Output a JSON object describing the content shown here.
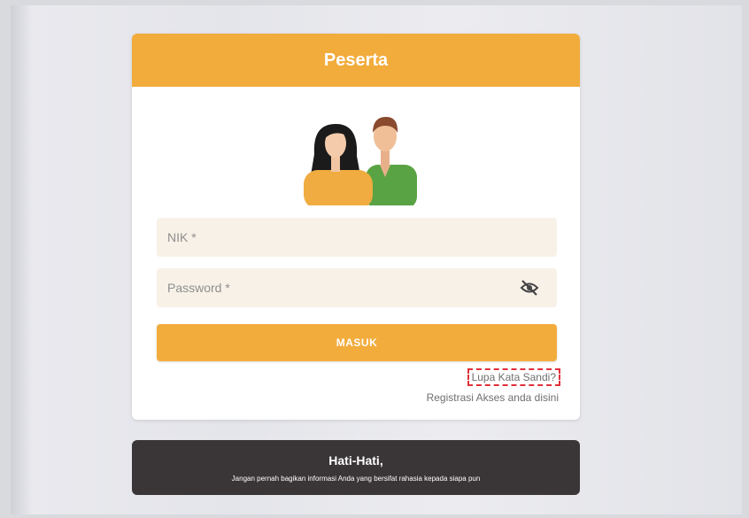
{
  "card": {
    "title": "Peserta"
  },
  "form": {
    "nik_placeholder": "NIK *",
    "password_placeholder": "Password *",
    "submit_label": "MASUK",
    "forgot_label": "Lupa Kata Sandi?",
    "register_label": "Registrasi Akses anda disini"
  },
  "warning": {
    "title": "Hati-Hati,",
    "text": "Jangan pernah bagikan informasi Anda yang bersifat rahasia kepada siapa pun"
  },
  "colors": {
    "accent": "#f2ac3c",
    "warning_bg": "#3a3536",
    "highlight_border": "#e0303a"
  },
  "icons": {
    "illustration": "two-people-illustration",
    "password_toggle": "eye-off-icon"
  }
}
